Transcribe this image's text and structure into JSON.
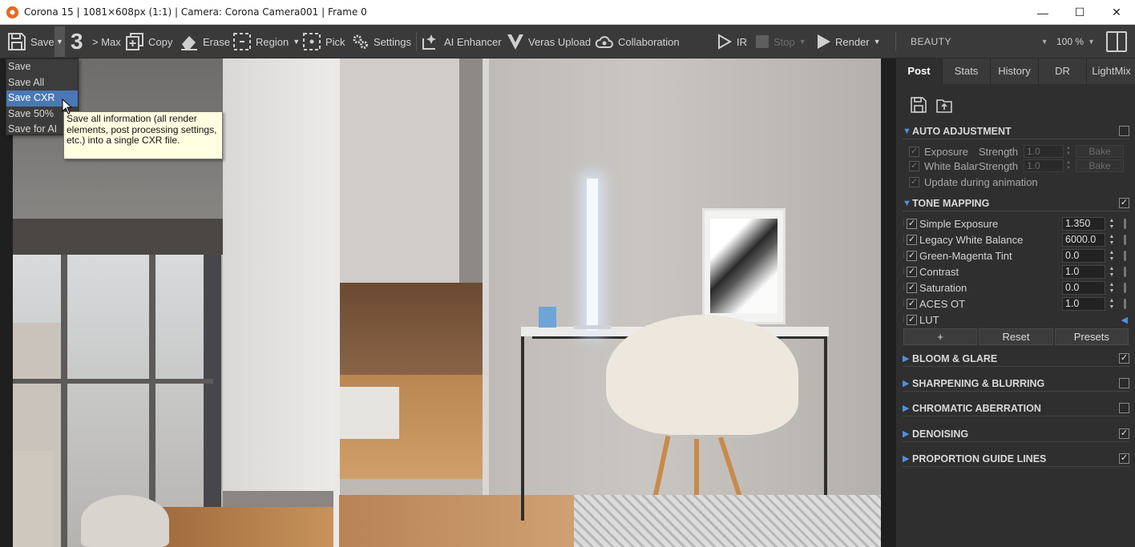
{
  "window": {
    "title": "Corona 15 | 1081×608px (1:1) | Camera: Corona Camera001 | Frame 0",
    "minimize_glyph": "—",
    "maximize_glyph": "☐",
    "close_glyph": "✕"
  },
  "toolbar": {
    "save": "Save",
    "passes": "3",
    "max": "> Max",
    "copy": "Copy",
    "erase": "Erase",
    "region": "Region",
    "pick": "Pick",
    "settings": "Settings",
    "ai_enhancer": "AI Enhancer",
    "veras_upload": "Veras Upload",
    "collaboration": "Collaboration",
    "ir": "IR",
    "stop": "Stop",
    "render": "Render",
    "render_element": "BEAUTY",
    "zoom": "100 %"
  },
  "save_menu": {
    "items": [
      "Save",
      "Save All",
      "Save CXR",
      "Save 50%",
      "Save for AI"
    ],
    "active_index": 2,
    "tooltip": "Save all information (all render elements, post processing settings, etc.) into a single CXR file."
  },
  "panel": {
    "tabs": [
      "Post",
      "Stats",
      "History",
      "DR",
      "LightMix"
    ],
    "active_tab": "Post",
    "auto_adjustment": {
      "title": "AUTO ADJUSTMENT",
      "enabled": false,
      "rows": [
        {
          "label": "Exposure",
          "strength_label": "Strength",
          "value": "1.0",
          "button": "Bake"
        },
        {
          "label": "White Balan",
          "strength_label": "Strength",
          "value": "1.0",
          "button": "Bake"
        }
      ],
      "update_label": "Update during animation"
    },
    "tone_mapping": {
      "title": "TONE MAPPING",
      "enabled": true,
      "rows": [
        {
          "label": "Simple Exposure",
          "value": "1.350"
        },
        {
          "label": "Legacy White Balance",
          "value": "6000.0"
        },
        {
          "label": "Green-Magenta Tint",
          "value": "0.0"
        },
        {
          "label": "Contrast",
          "value": "1.0"
        },
        {
          "label": "Saturation",
          "value": "0.0"
        },
        {
          "label": "ACES OT",
          "value": "1.0"
        },
        {
          "label": "LUT",
          "value": ""
        }
      ],
      "buttons": [
        "+",
        "Reset",
        "Presets"
      ]
    },
    "sections": [
      {
        "title": "BLOOM & GLARE",
        "enabled": true
      },
      {
        "title": "SHARPENING & BLURRING",
        "enabled": false
      },
      {
        "title": "CHROMATIC ABERRATION",
        "enabled": false
      },
      {
        "title": "DENOISING",
        "enabled": true
      },
      {
        "title": "PROPORTION GUIDE LINES",
        "enabled": true
      }
    ]
  },
  "colors": {
    "accent": "#4a78b6",
    "section_triangle": "#4f8fe0",
    "tooltip_bg": "#ffffe1"
  }
}
